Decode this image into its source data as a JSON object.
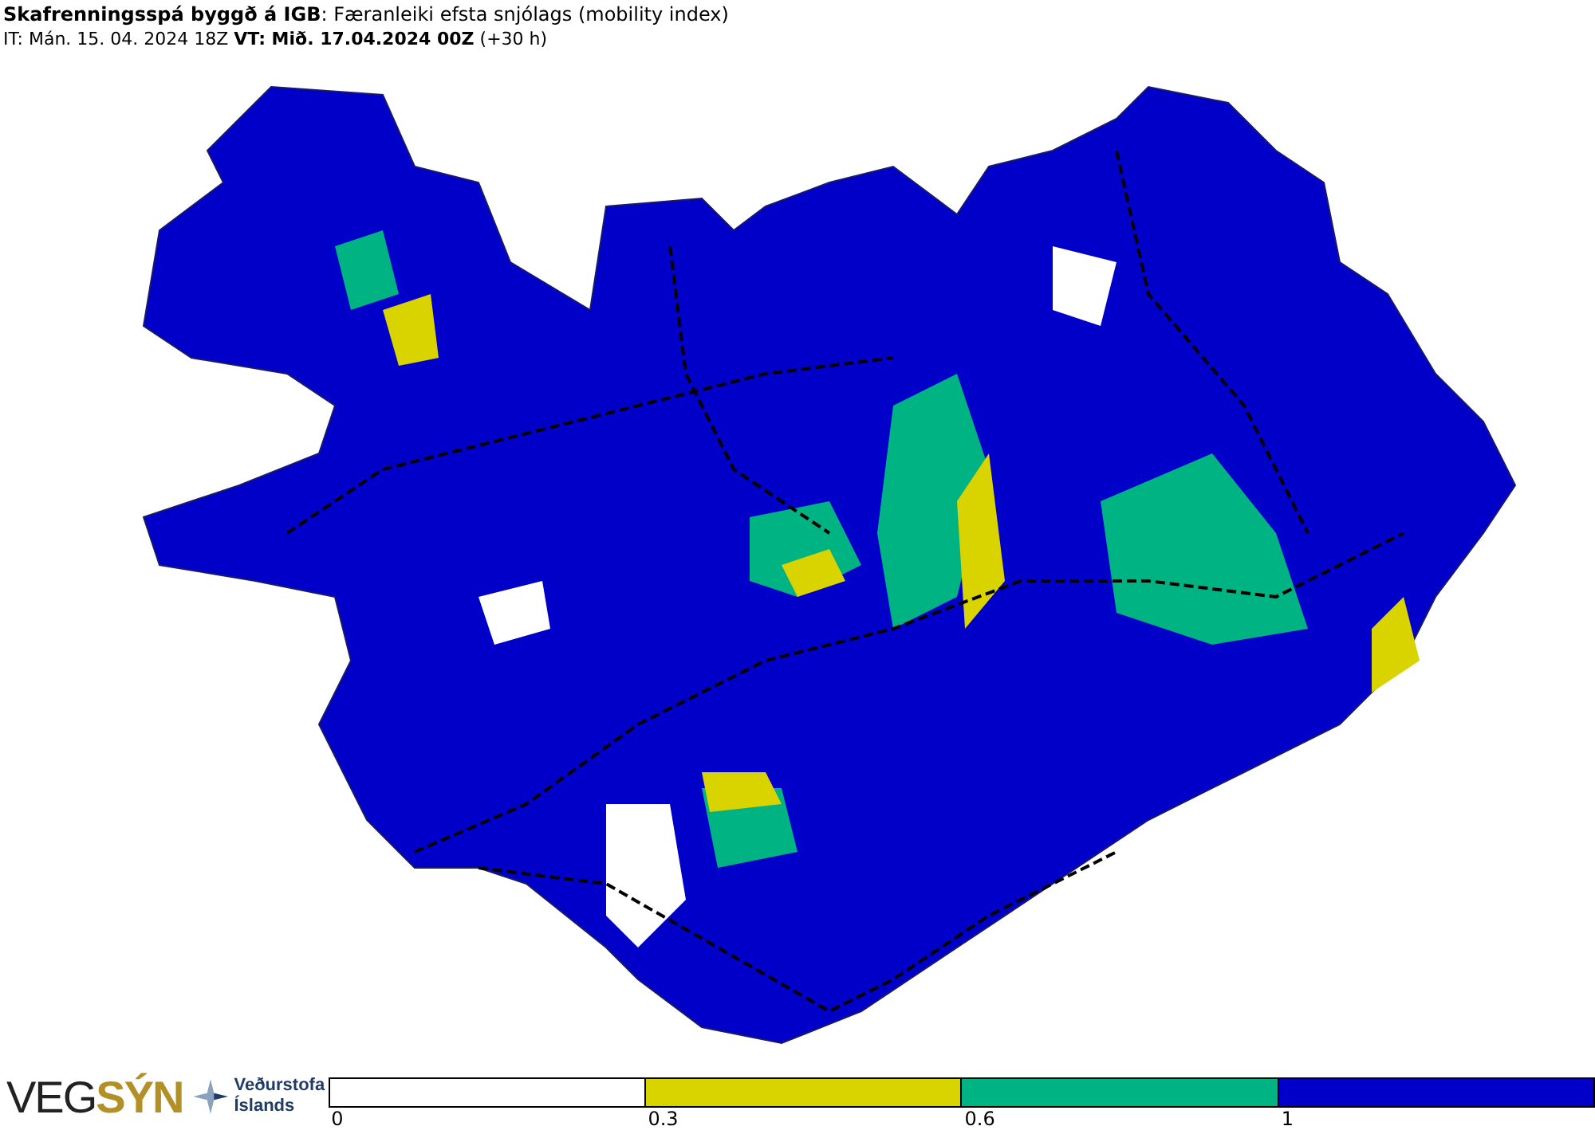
{
  "header": {
    "title": "**Skafrenningsspá byggð á IGB**: Færanleiki efsta snjólags (mobility index)",
    "subtitle": "IT: Mán. 15. 04. 2024 18Z **VT: Mið. 17.04.2024 00Z** (+30 h)"
  },
  "logos": {
    "vegsyn": [
      "VEG",
      "SÝN"
    ],
    "agency": [
      "Veðurstofa",
      "Íslands"
    ]
  },
  "legend": {
    "segments": [
      {
        "color": "#ffffff",
        "label": "0"
      },
      {
        "color": "#d9d300",
        "label": "0.3"
      },
      {
        "color": "#00b383",
        "label": "0.6"
      },
      {
        "color": "#0000c8",
        "label": "1"
      }
    ]
  }
}
